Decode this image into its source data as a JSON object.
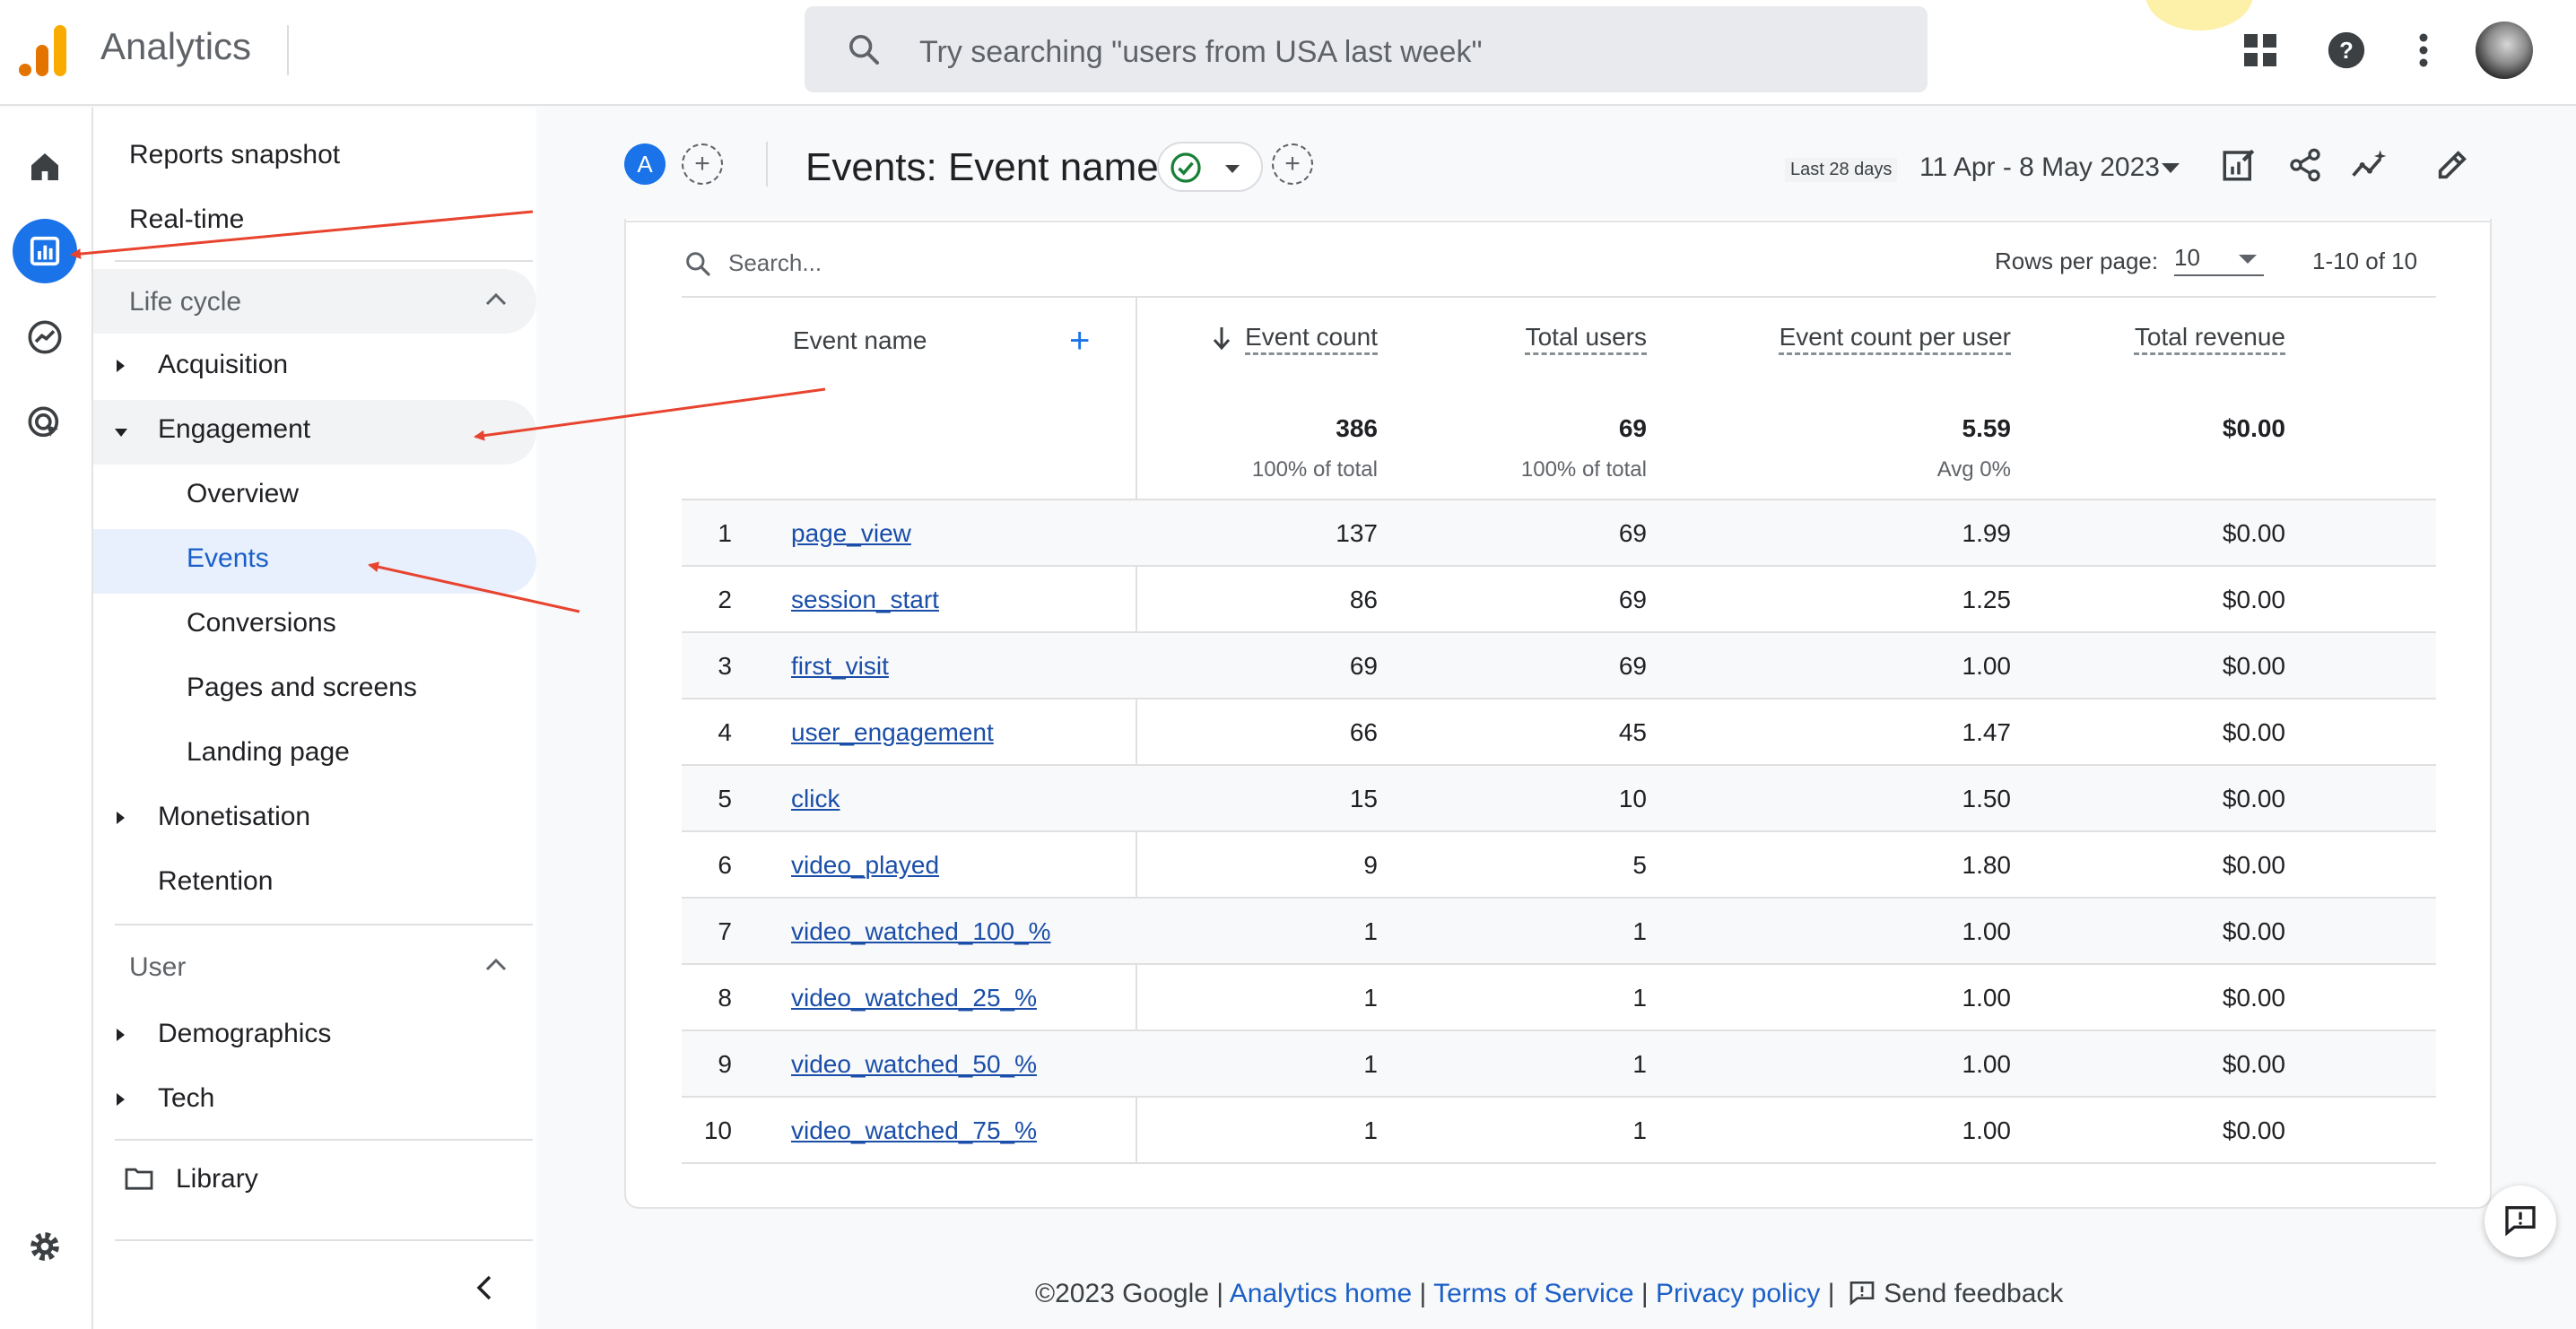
{
  "app": {
    "title": "Analytics"
  },
  "search": {
    "placeholder": "Try searching \"users from USA last week\""
  },
  "nav": {
    "reports_snapshot": "Reports snapshot",
    "realtime": "Real-time",
    "lifecycle": "Life cycle",
    "acquisition": "Acquisition",
    "engagement": "Engagement",
    "overview": "Overview",
    "events": "Events",
    "conversions": "Conversions",
    "pages_screens": "Pages and screens",
    "landing_page": "Landing page",
    "monetisation": "Monetisation",
    "retention": "Retention",
    "user": "User",
    "demographics": "Demographics",
    "tech": "Tech",
    "library": "Library"
  },
  "report": {
    "avatar_letter": "A",
    "title": "Events: Event name",
    "date_label": "Last 28 days",
    "date_range": "11 Apr - 8 May 2023"
  },
  "table": {
    "search_placeholder": "Search...",
    "rows_per_page_label": "Rows per page:",
    "rows_per_page": "10",
    "pager": "1-10 of 10",
    "headers": {
      "event_name": "Event name",
      "event_count": "Event count",
      "total_users": "Total users",
      "per_user": "Event count per user",
      "revenue": "Total revenue"
    },
    "totals": {
      "event_count": "386",
      "event_count_sub": "100% of total",
      "total_users": "69",
      "total_users_sub": "100% of total",
      "per_user": "5.59",
      "per_user_sub": "Avg 0%",
      "revenue": "$0.00"
    },
    "rows": [
      {
        "idx": "1",
        "name": "page_view",
        "count": "137",
        "users": "69",
        "per_user": "1.99",
        "revenue": "$0.00"
      },
      {
        "idx": "2",
        "name": "session_start",
        "count": "86",
        "users": "69",
        "per_user": "1.25",
        "revenue": "$0.00"
      },
      {
        "idx": "3",
        "name": "first_visit",
        "count": "69",
        "users": "69",
        "per_user": "1.00",
        "revenue": "$0.00"
      },
      {
        "idx": "4",
        "name": "user_engagement",
        "count": "66",
        "users": "45",
        "per_user": "1.47",
        "revenue": "$0.00"
      },
      {
        "idx": "5",
        "name": "click",
        "count": "15",
        "users": "10",
        "per_user": "1.50",
        "revenue": "$0.00"
      },
      {
        "idx": "6",
        "name": "video_played",
        "count": "9",
        "users": "5",
        "per_user": "1.80",
        "revenue": "$0.00"
      },
      {
        "idx": "7",
        "name": "video_watched_100_%",
        "count": "1",
        "users": "1",
        "per_user": "1.00",
        "revenue": "$0.00"
      },
      {
        "idx": "8",
        "name": "video_watched_25_%",
        "count": "1",
        "users": "1",
        "per_user": "1.00",
        "revenue": "$0.00"
      },
      {
        "idx": "9",
        "name": "video_watched_50_%",
        "count": "1",
        "users": "1",
        "per_user": "1.00",
        "revenue": "$0.00"
      },
      {
        "idx": "10",
        "name": "video_watched_75_%",
        "count": "1",
        "users": "1",
        "per_user": "1.00",
        "revenue": "$0.00"
      }
    ]
  },
  "footer": {
    "copyright": "©2023 Google",
    "sep": "|",
    "analytics_home": "Analytics home",
    "terms": "Terms of Service",
    "privacy": "Privacy policy",
    "feedback": "Send feedback"
  },
  "colors": {
    "accent": "#1a73e8",
    "link": "#1a4ea8",
    "annotation_arrow": "#e8432e",
    "selected_nav": "#e8f0fe"
  }
}
